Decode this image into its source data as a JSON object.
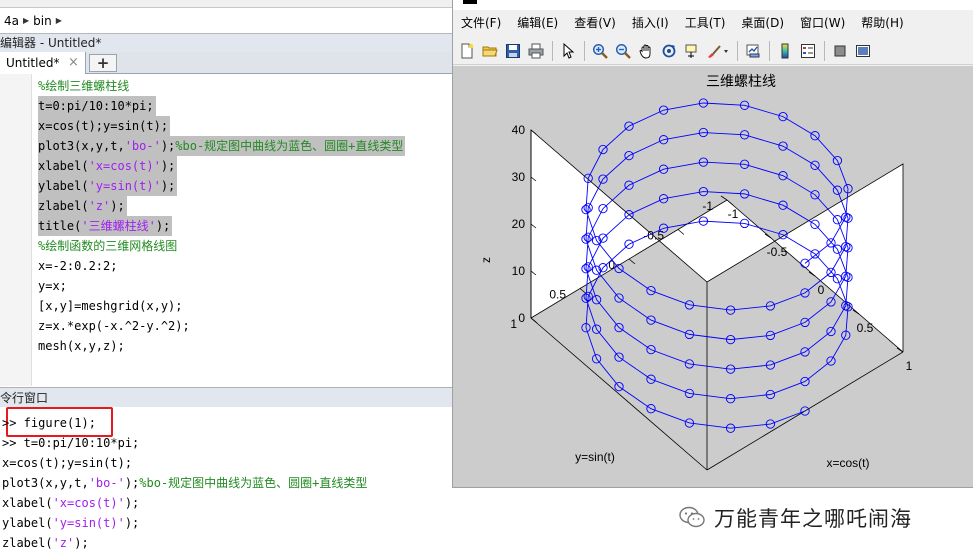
{
  "path": {
    "segments": [
      "4a",
      "bin"
    ]
  },
  "editor": {
    "title": "编辑器 - Untitled*",
    "tab_label": "Untitled*",
    "close_glyph": "×",
    "add_glyph": "+",
    "lines": [
      {
        "text": "%绘制三维螺柱线",
        "kind": "comment",
        "selected": false
      },
      {
        "text": "t=0:pi/10:10*pi;",
        "kind": "code",
        "selected": true
      },
      {
        "text": "x=cos(t);y=sin(t);",
        "kind": "code",
        "selected": true
      },
      {
        "parts": [
          "plot3(x,y,t,",
          "'bo-'",
          ");",
          "%bo-规定图中曲线为蓝色、圆圈+直线类型"
        ],
        "selected": true
      },
      {
        "parts": [
          "xlabel(",
          "'x=cos(t)'",
          ");"
        ],
        "selected": true
      },
      {
        "parts": [
          "ylabel(",
          "'y=sin(t)'",
          ");"
        ],
        "selected": true
      },
      {
        "parts": [
          "zlabel(",
          "'z'",
          ");"
        ],
        "selected": true
      },
      {
        "parts": [
          "title(",
          "'三维螺柱线'",
          ");"
        ],
        "selected": true
      },
      {
        "text": "%绘制函数的三维网格线图",
        "kind": "comment",
        "selected": false
      },
      {
        "text": "x=-2:0.2:2;",
        "kind": "code",
        "selected": false
      },
      {
        "text": "y=x;",
        "kind": "code",
        "selected": false
      },
      {
        "text": "[x,y]=meshgrid(x,y);",
        "kind": "code",
        "selected": false
      },
      {
        "text": "z=x.*exp(-x.^2-y.^2);",
        "kind": "code",
        "selected": false
      },
      {
        "text": "mesh(x,y,z);",
        "kind": "code",
        "selected": false
      }
    ]
  },
  "command_window": {
    "title": "令行窗口",
    "lines": [
      {
        "text": ">> figure(1);"
      },
      {
        "text": ">> t=0:pi/10:10*pi;"
      },
      {
        "text": "x=cos(t);y=sin(t);"
      },
      {
        "parts": [
          "plot3(x,y,t,",
          "'bo-'",
          ");",
          "%bo-规定图中曲线为蓝色、圆圈+直线类型"
        ]
      },
      {
        "parts": [
          "xlabel(",
          "'x=cos(t)'",
          ");"
        ]
      },
      {
        "parts": [
          "ylabel(",
          "'y=sin(t)'",
          ");"
        ]
      },
      {
        "parts": [
          "zlabel(",
          "'z'",
          ");"
        ]
      }
    ]
  },
  "figure": {
    "menu": [
      "文件(F)",
      "编辑(E)",
      "查看(V)",
      "插入(I)",
      "工具(T)",
      "桌面(D)",
      "窗口(W)",
      "帮助(H)"
    ],
    "toolbar_icons": [
      "new-figure-icon",
      "open-file-icon",
      "save-icon",
      "print-icon",
      "edit-plot-arrow-icon",
      "zoom-in-icon",
      "zoom-out-icon",
      "pan-hand-icon",
      "rotate-3d-icon",
      "data-cursor-icon",
      "brush-icon",
      "link-plot-icon",
      "insert-colorbar-icon",
      "insert-legend-icon",
      "hide-plot-tools-icon",
      "show-plot-tools-icon"
    ]
  },
  "chart_data": {
    "type": "line",
    "title": "三维螺柱线",
    "xlabel": "x=cos(t)",
    "ylabel": "y=sin(t)",
    "zlabel": "z",
    "series": [
      {
        "x_expr": "cos(t)",
        "y_expr": "sin(t)",
        "z_expr": "t",
        "t_start": 0,
        "t_step_over_pi": 0.1,
        "t_end_over_pi": 10,
        "marker": "o",
        "line": "-",
        "color": "#0000ff"
      }
    ],
    "xlim": [
      -1,
      1
    ],
    "ylim": [
      -1,
      1
    ],
    "zlim": [
      0,
      40
    ],
    "xticks": [
      "-1",
      "-0.5",
      "0",
      "0.5",
      "1"
    ],
    "yticks": [
      "-1",
      "-0.5",
      "0",
      "0.5",
      "1"
    ],
    "zticks": [
      "0",
      "10",
      "20",
      "30",
      "40"
    ],
    "grid": false,
    "background": "#ffffff",
    "figure_background": "#cccccc"
  },
  "watermark": {
    "text": "万能青年之哪吒闹海"
  }
}
